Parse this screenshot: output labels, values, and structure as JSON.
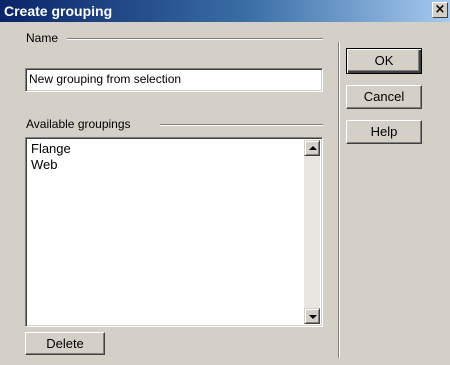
{
  "window": {
    "title": "Create grouping",
    "close_glyph": "×"
  },
  "name_section": {
    "label": "Name",
    "value": "New grouping from selection"
  },
  "groupings_section": {
    "label": "Available groupings",
    "items": [
      "Flange",
      "Web"
    ]
  },
  "buttons": {
    "delete": "Delete",
    "ok": "OK",
    "cancel": "Cancel",
    "help": "Help"
  },
  "colors": {
    "titlebar_start": "#0a246a",
    "titlebar_end": "#a6caf0",
    "dialog_bg": "#d4d0c8"
  }
}
